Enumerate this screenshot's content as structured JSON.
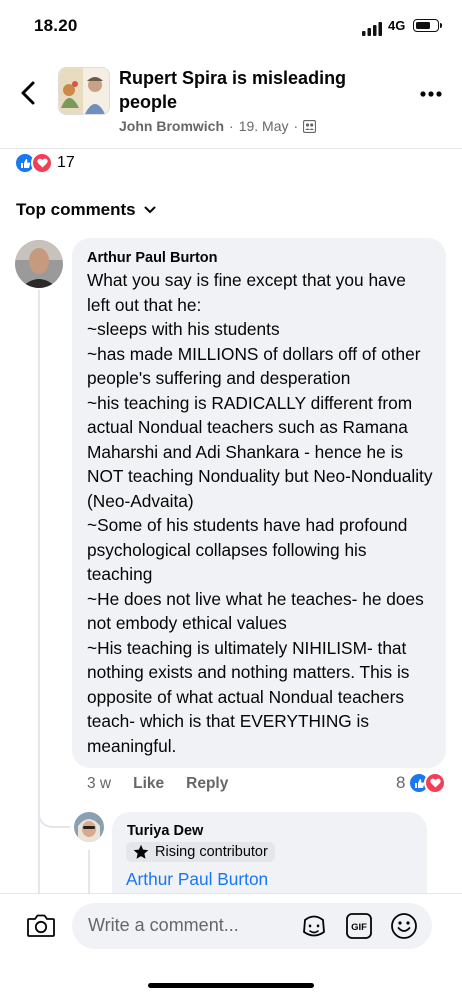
{
  "status_bar": {
    "time": "18.20",
    "network": "4G"
  },
  "post": {
    "title": "Rupert Spira is misleading people",
    "author": "John Bromwich",
    "separator": "·",
    "date": "19. May",
    "separator2": "·"
  },
  "reactions": {
    "count": "17",
    "like_color": "#1877f2",
    "love_color": "#f33e58"
  },
  "sort_label": "Top comments",
  "comments": [
    {
      "author": "Arthur Paul Burton",
      "text": "What you say is fine except that you have left out that he:\n~sleeps with his students\n~has made MILLIONS of dollars off of other people's suffering and desperation\n~his teaching is RADICALLY different from actual Nondual teachers such as Ramana Maharshi and Adi Shankara - hence he is NOT teaching Nonduality but Neo-Nonduality (Neo-Advaita)\n~Some of his students have had profound psychological collapses following his teaching\n~He does not live what he teaches- he does not embody ethical values\n~His teaching is ultimately NIHILISM- that nothing exists and nothing matters. This is opposite of what actual Nondual teachers teach- which is that EVERYTHING is meaningful.",
      "time": "3 w",
      "like_label": "Like",
      "reply_label": "Reply",
      "reaction_count": "8"
    }
  ],
  "reply": {
    "author": "Turiya Dew",
    "badge": "Rising contributor",
    "mention": "Arthur Paul Burton"
  },
  "composer": {
    "placeholder": "Write a comment..."
  }
}
